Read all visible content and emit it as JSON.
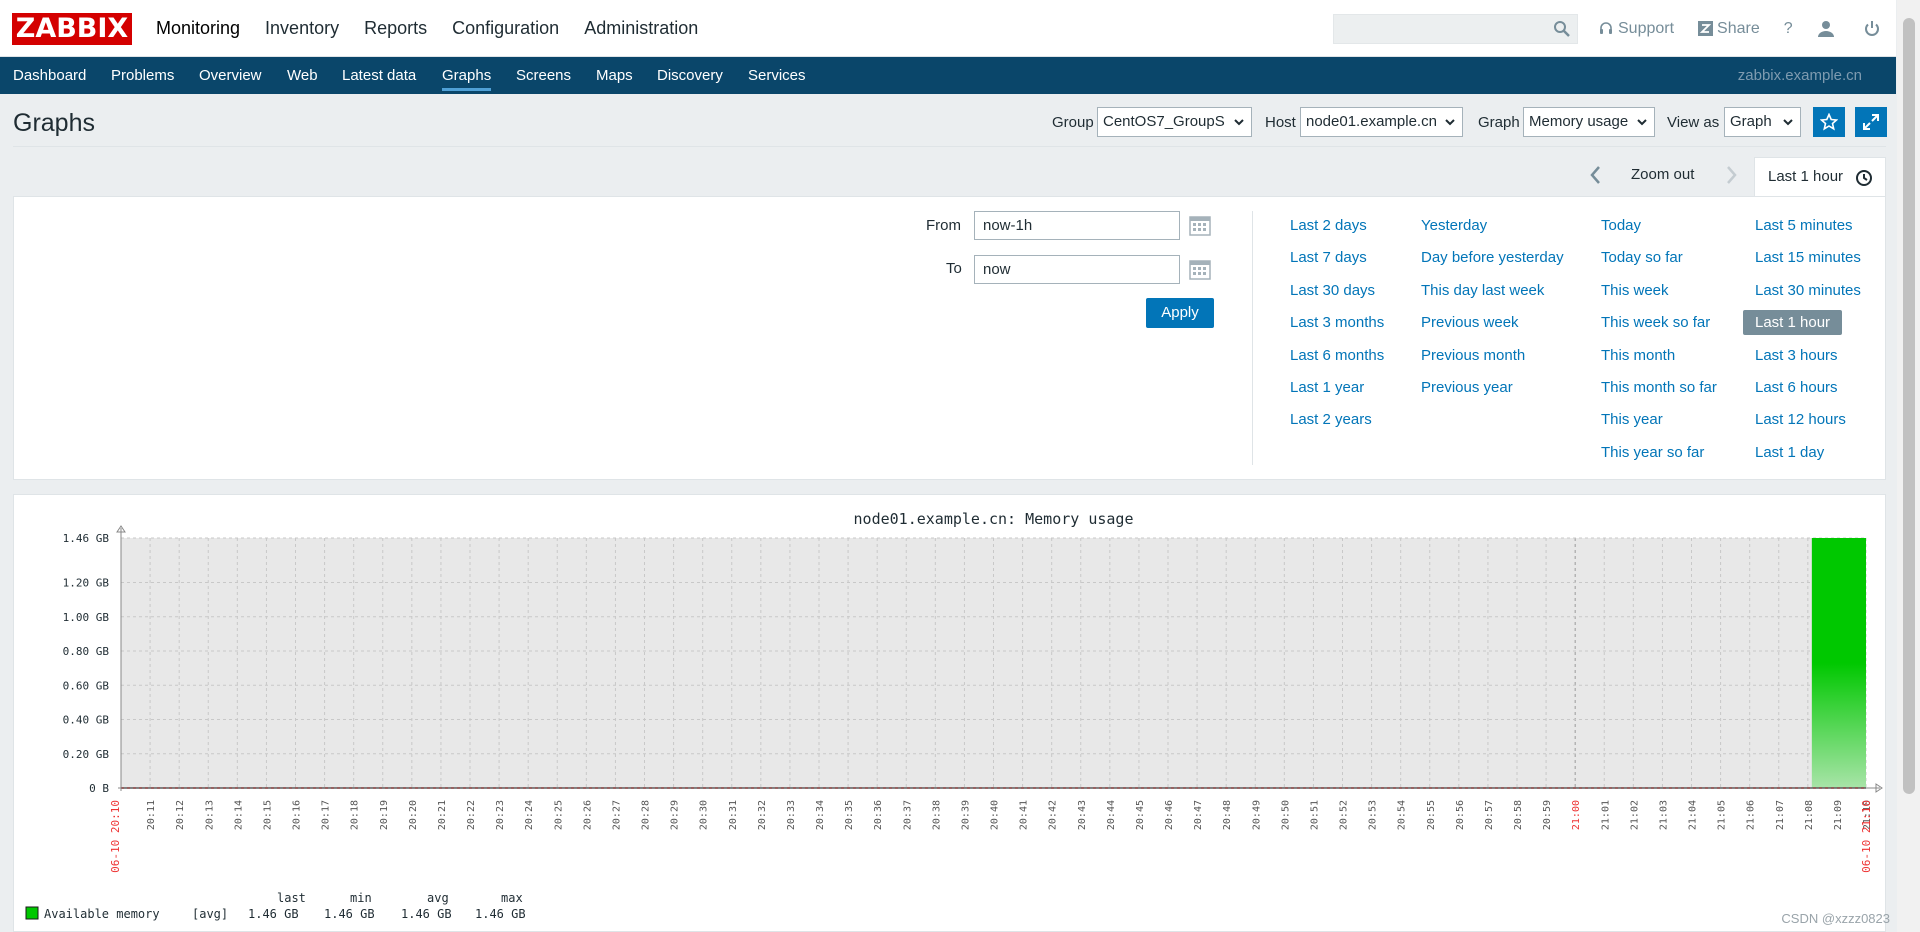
{
  "app": {
    "logo": "ZABBIX"
  },
  "main_menu": [
    "Monitoring",
    "Inventory",
    "Reports",
    "Configuration",
    "Administration"
  ],
  "search": {
    "value": "",
    "placeholder": ""
  },
  "top_right": {
    "support": "Support",
    "share": "Share",
    "help": "?"
  },
  "subnav": {
    "items": [
      "Dashboard",
      "Problems",
      "Overview",
      "Web",
      "Latest data",
      "Graphs",
      "Screens",
      "Maps",
      "Discovery",
      "Services"
    ],
    "active": "Graphs",
    "server": "zabbix.example.cn"
  },
  "page": {
    "title": "Graphs"
  },
  "filters": {
    "group_label": "Group",
    "group_value": "CentOS7_GroupS",
    "host_label": "Host",
    "host_value": "node01.example.cn",
    "graph_label": "Graph",
    "graph_value": "Memory usage",
    "view_label": "View as",
    "view_value": "Graph"
  },
  "time": {
    "zoom_out": "Zoom out",
    "current": "Last 1 hour",
    "from_label": "From",
    "from_value": "now-1h",
    "to_label": "To",
    "to_value": "now",
    "apply": "Apply",
    "quick": [
      [
        "Last 2 days",
        "Last 7 days",
        "Last 30 days",
        "Last 3 months",
        "Last 6 months",
        "Last 1 year",
        "Last 2 years"
      ],
      [
        "Yesterday",
        "Day before yesterday",
        "This day last week",
        "Previous week",
        "Previous month",
        "Previous year"
      ],
      [
        "Today",
        "Today so far",
        "This week",
        "This week so far",
        "This month",
        "This month so far",
        "This year",
        "This year so far"
      ],
      [
        "Last 5 minutes",
        "Last 15 minutes",
        "Last 30 minutes",
        "Last 1 hour",
        "Last 3 hours",
        "Last 6 hours",
        "Last 12 hours",
        "Last 1 day"
      ]
    ],
    "selected": "Last 1 hour"
  },
  "chart_data": {
    "type": "area",
    "title": "node01.example.cn: Memory usage",
    "y_ticks": [
      "1.46 GB",
      "1.20 GB",
      "1.00 GB",
      "0.80 GB",
      "0.60 GB",
      "0.40 GB",
      "0.20 GB",
      "0 B"
    ],
    "y_values": [
      1.46,
      1.2,
      1.0,
      0.8,
      0.6,
      0.4,
      0.2,
      0
    ],
    "ylim": [
      0,
      1.46
    ],
    "grid": true,
    "x_ticks": [
      "20:11",
      "20:12",
      "20:13",
      "20:14",
      "20:15",
      "20:16",
      "20:17",
      "20:18",
      "20:19",
      "20:20",
      "20:21",
      "20:22",
      "20:23",
      "20:24",
      "20:25",
      "20:26",
      "20:27",
      "20:28",
      "20:29",
      "20:30",
      "20:31",
      "20:32",
      "20:33",
      "20:34",
      "20:35",
      "20:36",
      "20:37",
      "20:38",
      "20:39",
      "20:40",
      "20:41",
      "20:42",
      "20:43",
      "20:44",
      "20:45",
      "20:46",
      "20:47",
      "20:48",
      "20:49",
      "20:50",
      "20:51",
      "20:52",
      "20:53",
      "20:54",
      "20:55",
      "20:56",
      "20:57",
      "20:58",
      "20:59",
      "21:00",
      "21:01",
      "21:02",
      "21:03",
      "21:04",
      "21:05",
      "21:06",
      "21:07",
      "21:08",
      "21:09",
      "21:10"
    ],
    "x_start_label": "06-10 20:10",
    "x_end_label": "06-10 21:10",
    "series": [
      {
        "name": "Available memory",
        "color": "#00c800",
        "from": "21:08",
        "to": "21:10",
        "value": 1.46
      }
    ],
    "legend": {
      "headers": [
        "last",
        "min",
        "avg",
        "max"
      ],
      "rows": [
        {
          "name": "Available memory",
          "func": "[avg]",
          "last": "1.46 GB",
          "min": "1.46 GB",
          "avg": "1.46 GB",
          "max": "1.46 GB",
          "color": "#00c800"
        }
      ]
    }
  },
  "watermark": "CSDN @xzzz0823"
}
